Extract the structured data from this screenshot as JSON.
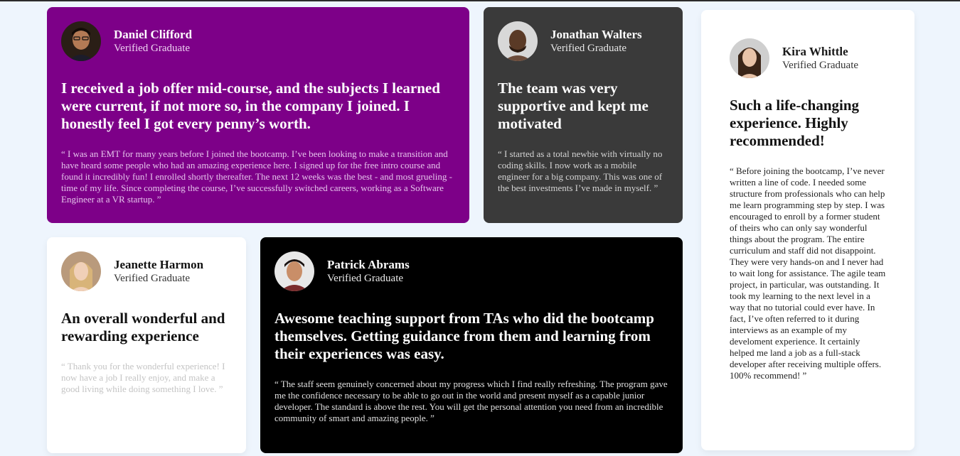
{
  "testimonials": [
    {
      "name": "Daniel Clifford",
      "status": "Verified Graduate",
      "headline": "I received a job offer mid-course, and the subjects I learned were current, if not more so, in the company I joined. I honestly feel I got every penny’s worth.",
      "quote": "“ I was an EMT for many years before I joined the bootcamp. I’ve been looking to make a transition and have heard some people who had an amazing experience here. I signed up for the free intro course and found it incredibly fun! I enrolled shortly thereafter. The next 12 weeks was the best - and most grueling - time of my life. Since completing the course, I’ve successfully switched careers, working as a Software Engineer at a VR startup. ”",
      "background": "#7d0088"
    },
    {
      "name": "Jonathan Walters",
      "status": "Verified Graduate",
      "headline": "The team was very supportive and kept me motivated",
      "quote": "“ I started as a total newbie with virtually no coding skills. I now work as a mobile engineer for a big company. This was one of the best investments I’ve made in myself. ”",
      "background": "#3a3a3a"
    },
    {
      "name": "Kira Whittle",
      "status": "Verified Graduate",
      "headline": "Such a life-changing experience. Highly recommended!",
      "quote": "“ Before joining the bootcamp, I’ve never written a line of code. I needed some structure from professionals who can help me learn programming step by step. I was encouraged to enroll by a former student of theirs who can only say wonderful things about the program. The entire curriculum and staff did not disappoint. They were very hands-on and I never had to wait long for assistance. The agile team project, in particular, was outstanding. It took my learning to the next level in a way that no tutorial could ever have. In fact, I’ve often referred to it during interviews as an example of my develoment experience. It certainly helped me land a job as a full-stack developer after receiving multiple offers. 100% recommend! ”",
      "background": "#ffffff"
    },
    {
      "name": "Jeanette Harmon",
      "status": "Verified Graduate",
      "headline": "An overall wonderful and rewarding experience",
      "quote": "“ Thank you for the wonderful experience! I now have a job I really enjoy, and make a good living while doing something I love. ”",
      "background": "#ffffff"
    },
    {
      "name": "Patrick Abrams",
      "status": "Verified Graduate",
      "headline": "Awesome teaching support from TAs who did the bootcamp themselves. Getting guidance from them and learning from their experiences was easy.",
      "quote": "“ The staff seem genuinely concerned about my progress which I find really refreshing. The program gave me the confidence necessary to be able to go out in the world and present myself as a capable junior developer. The standard is above the rest. You will get the personal attention you need from an incredible community of smart and amazing people. ”",
      "background": "#000000"
    }
  ]
}
